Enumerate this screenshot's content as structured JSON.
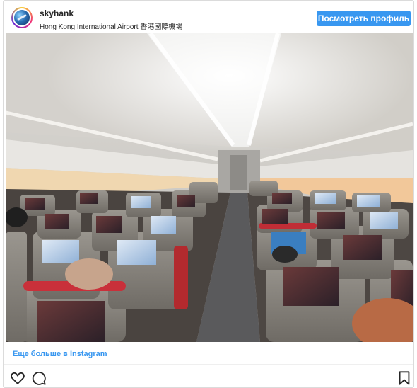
{
  "post": {
    "username": "skyhank",
    "location": "Hong Kong International Airport 香港國際機場",
    "profile_button_label": "Посмотреть профиль",
    "photo_alt": "photo",
    "more_link_label": "Еще больше в Instagram"
  },
  "icons": {
    "like": "heart-icon",
    "comment": "comment-icon",
    "save": "bookmark-icon"
  },
  "colors": {
    "accent": "#3897f0",
    "text": "#262626",
    "border": "#dbdbdb"
  }
}
